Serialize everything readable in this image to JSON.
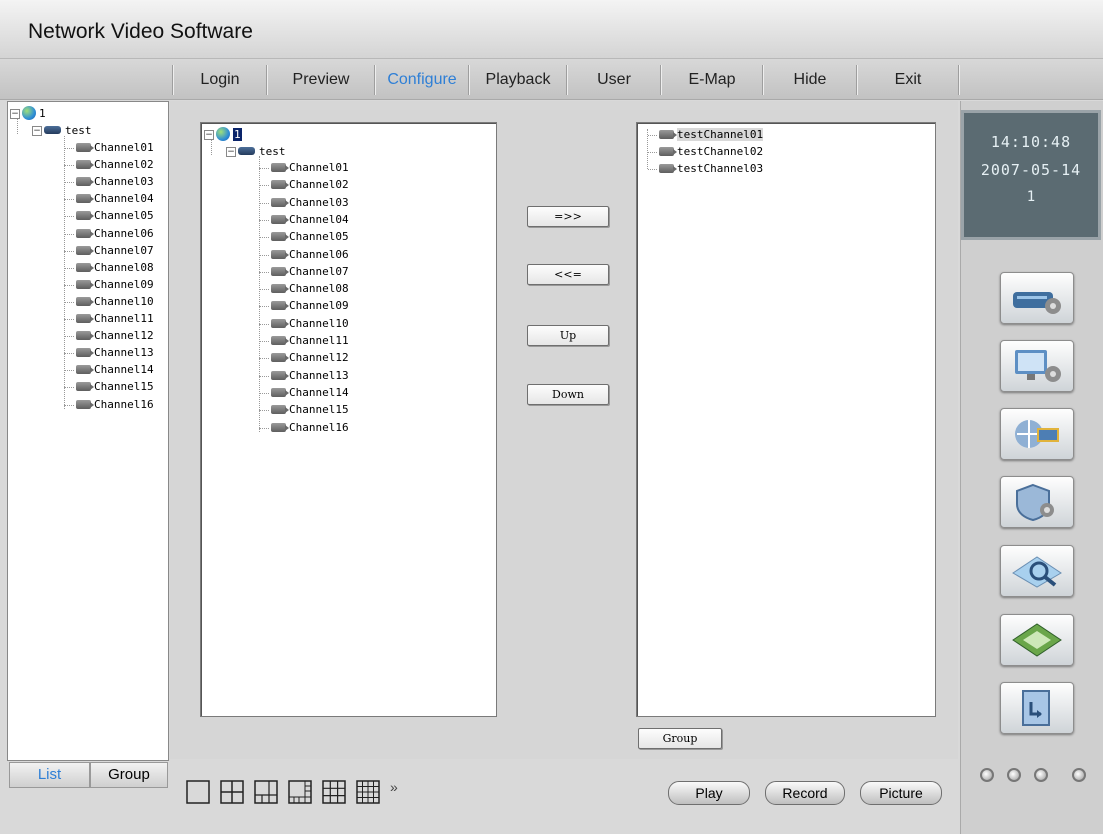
{
  "title": "Network Video Software",
  "menu": {
    "items": [
      {
        "label": "Login"
      },
      {
        "label": "Preview"
      },
      {
        "label": "Configure"
      },
      {
        "label": "Playback"
      },
      {
        "label": "User"
      },
      {
        "label": "E-Map"
      },
      {
        "label": "Hide"
      },
      {
        "label": "Exit"
      }
    ],
    "active": "Configure",
    "active_color": "#2e7fd6"
  },
  "left_tree": {
    "root": "1",
    "device": "test",
    "channels": [
      "Channel01",
      "Channel02",
      "Channel03",
      "Channel04",
      "Channel05",
      "Channel06",
      "Channel07",
      "Channel08",
      "Channel09",
      "Channel10",
      "Channel11",
      "Channel12",
      "Channel13",
      "Channel14",
      "Channel15",
      "Channel16"
    ]
  },
  "left_tabs": {
    "list": "List",
    "group": "Group"
  },
  "source_tree": {
    "root": "1",
    "device": "test",
    "channels": [
      "Channel01",
      "Channel02",
      "Channel03",
      "Channel04",
      "Channel05",
      "Channel06",
      "Channel07",
      "Channel08",
      "Channel09",
      "Channel10",
      "Channel11",
      "Channel12",
      "Channel13",
      "Channel14",
      "Channel15",
      "Channel16"
    ]
  },
  "actions": {
    "add": "=>>",
    "remove": "<<=",
    "up": "Up",
    "down": "Down",
    "group": "Group"
  },
  "group_list": {
    "items": [
      "testChannel01",
      "testChannel02",
      "testChannel03"
    ],
    "selected": "testChannel01"
  },
  "clock": {
    "time": "14:10:48",
    "date": "2007-05-14",
    "value": "1"
  },
  "side_buttons": [
    "device-config-icon",
    "monitor-config-icon",
    "network-config-icon",
    "security-config-icon",
    "search-icon",
    "card-config-icon",
    "exit-door-icon"
  ],
  "layout_more": "»",
  "playback_buttons": {
    "play": "Play",
    "record": "Record",
    "picture": "Picture"
  }
}
